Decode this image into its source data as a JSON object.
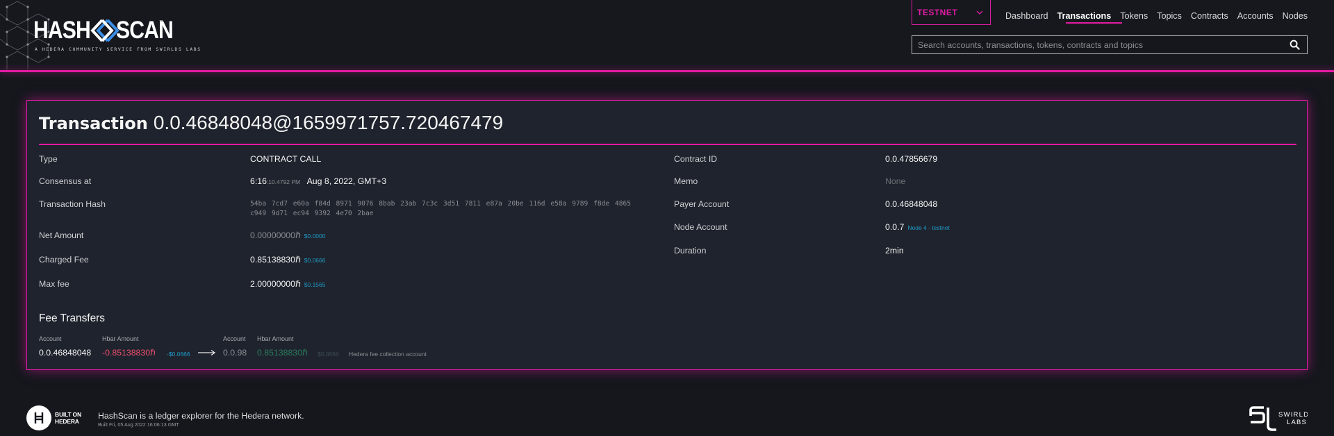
{
  "header": {
    "logo": {
      "word_left": "HASH",
      "word_right": "SCAN",
      "trademark": "™",
      "tagline": "A HEDERA COMMUNITY SERVICE FROM SWIRLDS LABS"
    },
    "network_select": {
      "value": "TESTNET"
    },
    "nav": [
      {
        "label": "Dashboard",
        "active": false
      },
      {
        "label": "Transactions",
        "active": true
      },
      {
        "label": "Tokens",
        "active": false
      },
      {
        "label": "Topics",
        "active": false
      },
      {
        "label": "Contracts",
        "active": false
      },
      {
        "label": "Accounts",
        "active": false
      },
      {
        "label": "Nodes",
        "active": false
      }
    ],
    "search": {
      "placeholder": "Search accounts, transactions, tokens, contracts and topics",
      "value": ""
    },
    "accent_color": "#e31ba3"
  },
  "transaction": {
    "title_label": "Transaction",
    "id": "0.0.46848048@1659971757.720467479",
    "left": {
      "type": {
        "label": "Type",
        "value": "CONTRACT CALL"
      },
      "consensus": {
        "label": "Consensus at",
        "time": "6:16",
        "fraction": ":10.4792 PM",
        "date": "Aug 8, 2022, GMT+3"
      },
      "hash": {
        "label": "Transaction Hash",
        "line1": "54ba 7cd7 e60a f84d 8971 9076 8bab 23ab 7c3c 3d51 7811 e87a 20be 116d e58a 9789 f8de 4865",
        "line2": "c949 9d71 ec94 9392 4e70 2bae"
      },
      "net_amount": {
        "label": "Net Amount",
        "value": "0.00000000ℏ",
        "usd": "$0.0000"
      },
      "charged_fee": {
        "label": "Charged Fee",
        "value": "0.85138830ℏ",
        "usd": "$0.0666"
      },
      "max_fee": {
        "label": "Max fee",
        "value": "2.00000000ℏ",
        "usd": "$0.1565"
      }
    },
    "right": {
      "contract_id": {
        "label": "Contract ID",
        "value": "0.0.47856679"
      },
      "memo": {
        "label": "Memo",
        "value": "None"
      },
      "payer": {
        "label": "Payer Account",
        "value": "0.0.46848048"
      },
      "node": {
        "label": "Node Account",
        "value": "0.0.7",
        "note": "Node 4 - testnet"
      },
      "duration": {
        "label": "Duration",
        "value": "2min"
      }
    },
    "fee_transfers": {
      "title": "Fee Transfers",
      "from": {
        "account_header": "Account",
        "amount_header": "Hbar Amount",
        "account": "0.0.46848048",
        "amount": "-0.85138830ℏ",
        "usd": "-$0.0666"
      },
      "to": {
        "account_header": "Account",
        "amount_header": "Hbar Amount",
        "account": "0.0.98",
        "amount": "0.85138830ℏ",
        "usd": "$0.0666",
        "note": "Hedera fee collection account"
      }
    }
  },
  "footer": {
    "built_on": {
      "line1": "BUILT ON",
      "line2": "HEDERA"
    },
    "description": "HashScan is a ledger explorer for the Hedera network.",
    "build_info": "Built Fri, 05 Aug 2022 16:06:13 GMT",
    "swirlds": {
      "line1": "SWIRLDS",
      "line2": "LABS"
    }
  }
}
